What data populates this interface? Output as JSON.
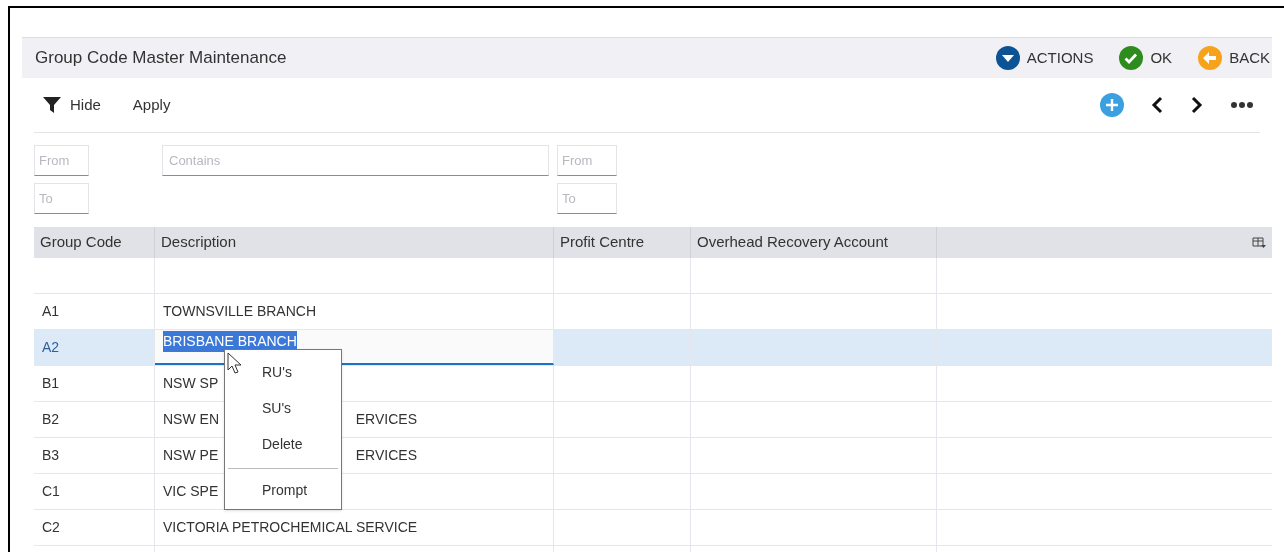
{
  "window": {
    "title": "Group Code Master Maintenance",
    "actions": [
      {
        "label": "ACTIONS",
        "kind": "actions"
      },
      {
        "label": "OK",
        "kind": "ok"
      },
      {
        "label": "BACK",
        "kind": "back"
      }
    ]
  },
  "toolbar": {
    "hide": "Hide",
    "apply": "Apply"
  },
  "filters": {
    "group_code": [
      {
        "placeholder": "From"
      },
      {
        "placeholder": "To"
      }
    ],
    "description": {
      "placeholder": "Contains"
    },
    "profit_centre": [
      {
        "placeholder": "From"
      },
      {
        "placeholder": "To"
      }
    ]
  },
  "table": {
    "columns": [
      "Group Code",
      "Description",
      "Profit Centre",
      "Overhead Recovery Account"
    ],
    "rows": [
      {
        "code": "",
        "description": "",
        "selected": false
      },
      {
        "code": "A1",
        "description": "TOWNSVILLE BRANCH",
        "selected": false
      },
      {
        "code": "A2",
        "description": "BRISBANE BRANCH",
        "selected": true
      },
      {
        "code": "B1",
        "description": "NSW SP",
        "selected": false
      },
      {
        "code": "B2",
        "description": "NSW EN",
        "tail": "ERVICES",
        "selected": false
      },
      {
        "code": "B3",
        "description": "NSW PE",
        "tail": "ERVICES",
        "selected": false
      },
      {
        "code": "C1",
        "description": "VIC SPE",
        "selected": false
      },
      {
        "code": "C2",
        "description": "VICTORIA PETROCHEMICAL SERVICE",
        "selected": false
      },
      {
        "code": "",
        "description": "",
        "selected": false
      }
    ]
  },
  "context_menu": {
    "items": [
      "RU's",
      "SU's",
      "Delete"
    ],
    "footer": "Prompt"
  }
}
